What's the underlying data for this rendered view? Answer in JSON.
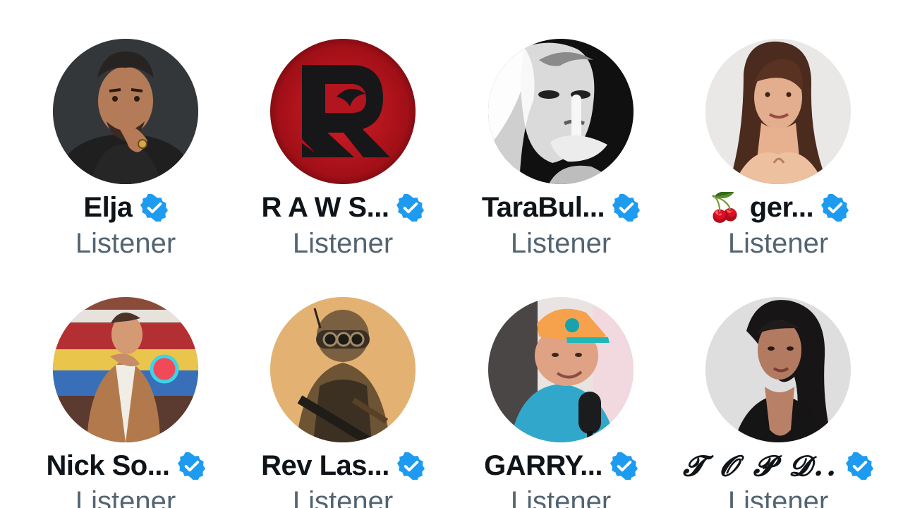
{
  "space": {
    "listeners": [
      {
        "name": "Elja",
        "role": "Listener",
        "verified": true,
        "avatar_icon": "man-thinking-avatar"
      },
      {
        "name": "R A W S...",
        "role": "Listener",
        "verified": true,
        "avatar_icon": "red-eagle-r-logo-avatar"
      },
      {
        "name": "TaraBul...",
        "role": "Listener",
        "verified": true,
        "avatar_icon": "bw-woman-shh-avatar"
      },
      {
        "name": "🍒 ger...",
        "role": "Listener",
        "verified": true,
        "avatar_icon": "woman-portrait-avatar"
      },
      {
        "name": "Nick So...",
        "role": "Listener",
        "verified": true,
        "avatar_icon": "man-store-avatar"
      },
      {
        "name": "Rev Las...",
        "role": "Listener",
        "verified": true,
        "avatar_icon": "soldier-avatar"
      },
      {
        "name": "GARRY...",
        "role": "Listener",
        "verified": true,
        "avatar_icon": "man-podcast-avatar"
      },
      {
        "name": "𝓣 𝓞 𝓟 𝓓...",
        "role": "Listener",
        "verified": true,
        "avatar_icon": "woman-dark-hair-avatar"
      }
    ]
  },
  "colors": {
    "verified": "#1d9bf0",
    "name_text": "#0f1419",
    "role_text": "#536471",
    "background": "#ffffff"
  }
}
